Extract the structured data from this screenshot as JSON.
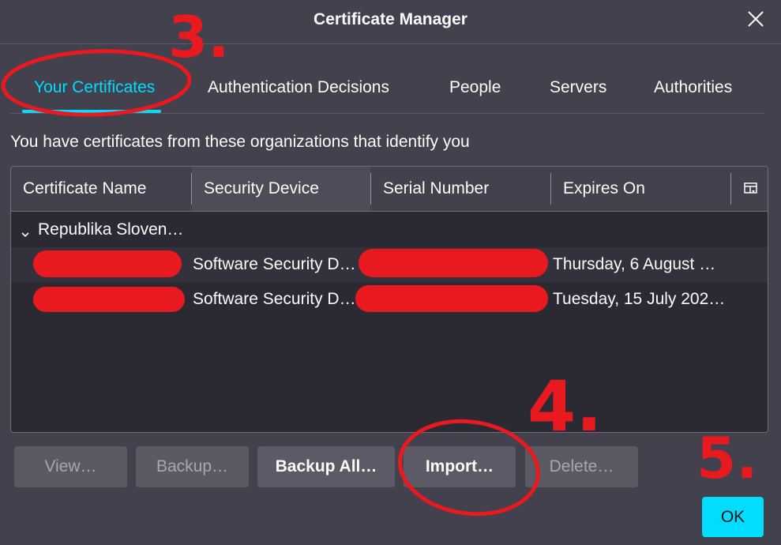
{
  "dialog": {
    "title": "Certificate Manager"
  },
  "tabs": [
    {
      "label": "Your Certificates",
      "active": true
    },
    {
      "label": "Authentication Decisions",
      "active": false
    },
    {
      "label": "People",
      "active": false
    },
    {
      "label": "Servers",
      "active": false
    },
    {
      "label": "Authorities",
      "active": false
    }
  ],
  "description": "You have certificates from these organizations that identify you",
  "table": {
    "columns": [
      "Certificate Name",
      "Security Device",
      "Serial Number",
      "Expires On"
    ],
    "column_picker_icon": "column-picker-icon",
    "group": {
      "label": "Republika Sloven…",
      "expanded": true
    },
    "rows": [
      {
        "security_device": "Software Security D…",
        "expires_on": "Thursday, 6 August …"
      },
      {
        "security_device": "Software Security D…",
        "expires_on": "Tuesday, 15 July 202…"
      }
    ]
  },
  "buttons": {
    "view": "View…",
    "backup": "Backup…",
    "backup_all": "Backup All…",
    "import": "Import…",
    "delete": "Delete…",
    "ok": "OK"
  },
  "annotations": {
    "step3": "3.",
    "step4": "4.",
    "step5": "5."
  },
  "colors": {
    "background": "#42414d",
    "accent": "#00ddff",
    "tree_bg": "#2b2a33",
    "annotation_red": "#e8191f"
  }
}
